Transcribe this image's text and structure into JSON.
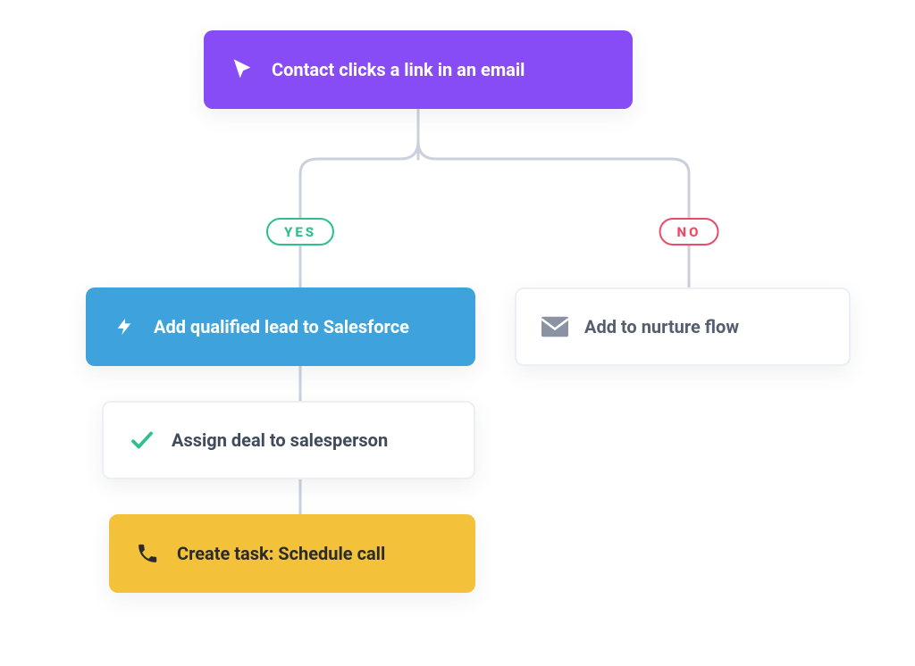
{
  "trigger": {
    "label": "Contact clicks a link in an email",
    "icon": "cursor-icon"
  },
  "branches": {
    "yes": {
      "label": "YES",
      "color": "#2EC08C",
      "steps": [
        {
          "icon": "bolt-icon",
          "label": "Add qualified lead to Salesforce"
        },
        {
          "icon": "check-icon",
          "label": "Assign deal to salesperson"
        },
        {
          "icon": "phone-icon",
          "label": "Create task: Schedule call"
        }
      ]
    },
    "no": {
      "label": "NO",
      "color": "#E64D6B",
      "steps": [
        {
          "icon": "envelope-icon",
          "label": "Add to nurture flow"
        }
      ]
    }
  },
  "colors": {
    "purple": "#874CF6",
    "blue": "#3EA3DC",
    "yellow": "#F3C13A",
    "line": "#CBD1DA",
    "textDark": "#3F4A5A"
  }
}
